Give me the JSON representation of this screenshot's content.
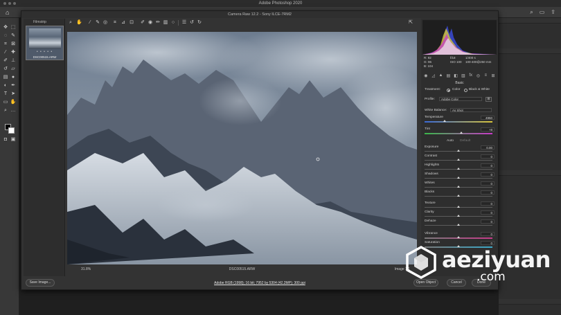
{
  "mac": {
    "title": "Adobe Photoshop 2020"
  },
  "dialog": {
    "title": "Camera Raw 12.2  -  Sony ILCE-7RM2",
    "filmstrip_header": "Filmstrip",
    "thumbnail_name": "DSC00515.ARW",
    "thumbnail_stars": "• • • • •",
    "zoom": "31.8%",
    "filename": "DSC00515.ARW",
    "image_count": "Image 1/1",
    "save_button": "Save Image...",
    "workflow_link": "Adobe RGB (1998); 16 bit; 7952 by 5304 (42.2MP); 300 ppi",
    "open_button": "Open Object",
    "cancel_button": "Cancel",
    "done_button": "Done"
  },
  "readout": {
    "r": "R:     92",
    "g": "G:     96",
    "b": "B:   104",
    "aperture": "f/18",
    "shutter": "1/400 s",
    "iso": "ISO 100",
    "lens": "100-400@250 mm"
  },
  "basic": {
    "section_title": "Basic",
    "treatment_label": "Treatment:",
    "color_option": "Color",
    "bw_option": "Black & White",
    "treatment_selected": "Color",
    "profile_label": "Profile:",
    "profile_value": "Adobe Color",
    "wb_label": "White Balance:",
    "wb_value": "As Shot",
    "auto_label": "Auto",
    "default_label": "Default",
    "sliders": [
      {
        "label": "Temperature",
        "value": "4950",
        "level": 0.3
      },
      {
        "label": "Tint",
        "value": "+8",
        "level": 0.54
      },
      {
        "label": "Exposure",
        "value": "0.00",
        "level": 0.5
      },
      {
        "label": "Contrast",
        "value": "0",
        "level": 0.5
      },
      {
        "label": "Highlights",
        "value": "0",
        "level": 0.5
      },
      {
        "label": "Shadows",
        "value": "0",
        "level": 0.5
      },
      {
        "label": "Whites",
        "value": "0",
        "level": 0.5
      },
      {
        "label": "Blacks",
        "value": "0",
        "level": 0.5
      },
      {
        "label": "Texture",
        "value": "0",
        "level": 0.5
      },
      {
        "label": "Clarity",
        "value": "0",
        "level": 0.5
      },
      {
        "label": "Dehaze",
        "value": "0",
        "level": 0.5
      },
      {
        "label": "Vibrance",
        "value": "0",
        "level": 0.5
      },
      {
        "label": "Saturation",
        "value": "0",
        "level": 0.5
      }
    ]
  },
  "watermark": {
    "brand": "aeziyuan",
    "tld": ".com"
  }
}
